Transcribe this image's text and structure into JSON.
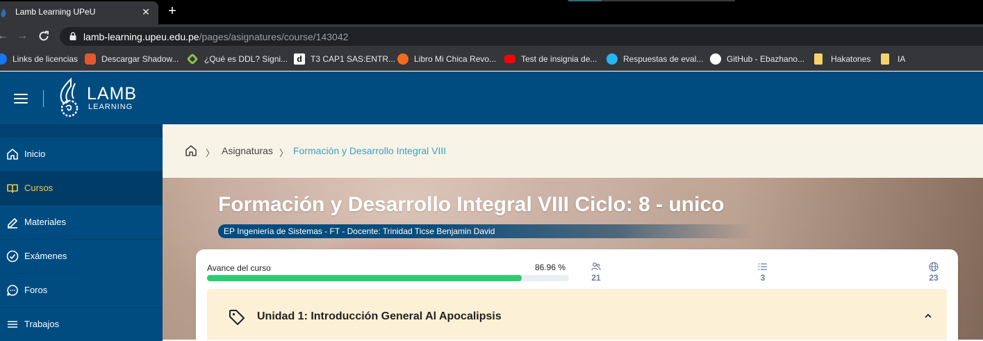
{
  "browser": {
    "tab_title": "Lamb Learning UPeU",
    "tab_close": "✕",
    "new_tab": "+",
    "url_domain": "lamb-learning.upeu.edu.pe",
    "url_path": "/pages/asignatures/course/143042",
    "bookmarks": [
      {
        "label": "Links de licencias",
        "icon": "facebook-icon",
        "color": "#1877f2"
      },
      {
        "label": "Descargar Shadow...",
        "icon": "gamepad-icon",
        "color": "#e4572e"
      },
      {
        "label": "¿Qué es DDL? Signi...",
        "icon": "diamond-icon",
        "color": "#8bc34a"
      },
      {
        "label": "T3 CAP1 SAS:ENTR...",
        "icon": "d-letter-icon",
        "color": "#ffffff"
      },
      {
        "label": "Libro Mi Chica Revo...",
        "icon": "book-icon",
        "color": "#f26b1d"
      },
      {
        "label": "Test de insignia de...",
        "icon": "youtube-icon",
        "color": "#ff0000"
      },
      {
        "label": "Respuestas de eval...",
        "icon": "ri-icon",
        "color": "#29b6f6"
      },
      {
        "label": "GitHub - Ebazhano...",
        "icon": "github-icon",
        "color": "#ffffff"
      },
      {
        "label": "Hakatones",
        "icon": "folder-icon",
        "color": "#f6d36b"
      },
      {
        "label": "IA",
        "icon": "folder-icon",
        "color": "#f6d36b"
      }
    ]
  },
  "header": {
    "logo_title": "LAMB",
    "logo_sub": "LEARNING"
  },
  "sidebar": {
    "items": [
      {
        "label": "Inicio",
        "icon": "home-icon",
        "active": false
      },
      {
        "label": "Cursos",
        "icon": "book-open-icon",
        "active": true
      },
      {
        "label": "Materiales",
        "icon": "pencil-icon",
        "active": false
      },
      {
        "label": "Exámenes",
        "icon": "check-circle-icon",
        "active": false
      },
      {
        "label": "Foros",
        "icon": "chat-icon",
        "active": false
      },
      {
        "label": "Trabajos",
        "icon": "list-icon",
        "active": false
      }
    ],
    "active_color": "#f5c842"
  },
  "breadcrumb": {
    "sep": "〉",
    "items": [
      "Asignaturas",
      "Formación y Desarrollo Integral VIII"
    ]
  },
  "course": {
    "title": "Formación y Desarrollo Integral VIII Ciclo: 8 - unico",
    "subtitle": "EP Ingeniería de Sistemas - FT - Docente: Trinidad Ticse Benjamin David",
    "progress_label": "Avance del curso",
    "progress_text": "86.96 %",
    "progress_fraction": 0.8696,
    "progress_color": "#2ecc71",
    "stats": [
      {
        "icon": "users-icon",
        "value": "21"
      },
      {
        "icon": "list-icon",
        "value": "3"
      },
      {
        "icon": "globe-icon",
        "value": "23"
      }
    ],
    "unit_title": "Unidad 1: Introducción General Al Apocalipsis"
  }
}
